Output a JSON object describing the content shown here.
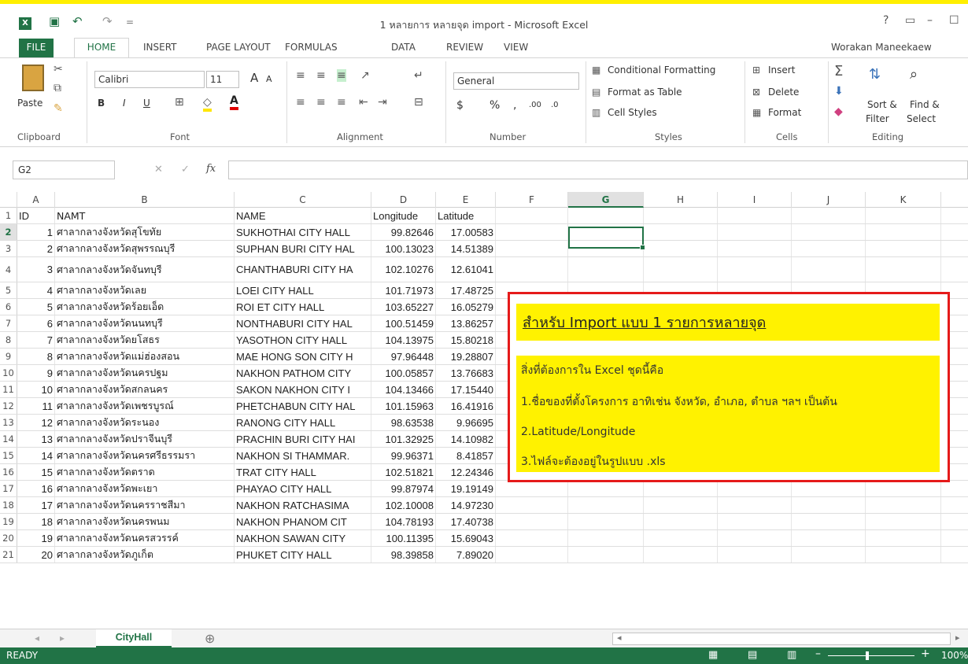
{
  "window": {
    "title": "1 หลายการ หลายจุด import - Microsoft Excel",
    "help": "?",
    "restore": "▭",
    "minimize": "–",
    "maximize": "☐"
  },
  "qat": {
    "undo": "↶",
    "redo": "↷",
    "save": "▣",
    "customize": "="
  },
  "tabs": [
    "FILE",
    "HOME",
    "INSERT",
    "PAGE LAYOUT",
    "FORMULAS",
    "DATA",
    "REVIEW",
    "VIEW"
  ],
  "user": "Worakan Maneekaew",
  "ribbon": {
    "clipboard": {
      "label": "Clipboard",
      "paste": "Paste"
    },
    "font": {
      "label": "Font",
      "name": "Calibri",
      "size": "11",
      "bold": "B",
      "italic": "I",
      "underline": "U",
      "grow": "A",
      "shrink": "A"
    },
    "alignment": {
      "label": "Alignment"
    },
    "number": {
      "label": "Number",
      "format": "General",
      "currency": "$",
      "percent": "%",
      "comma": ",",
      "inc_decimal": ".00",
      "dec_decimal": ".0"
    },
    "styles": {
      "label": "Styles",
      "conditional": "Conditional Formatting",
      "format_table": "Format as Table",
      "cell_styles": "Cell Styles"
    },
    "cells": {
      "label": "Cells",
      "insert": "Insert",
      "delete": "Delete",
      "format": "Format"
    },
    "editing": {
      "label": "Editing",
      "sort": "Sort &",
      "sort2": "Filter",
      "find": "Find &",
      "find2": "Select"
    }
  },
  "formula_bar": {
    "name_box": "G2",
    "fx": "fx",
    "value": ""
  },
  "columns": [
    "A",
    "B",
    "C",
    "D",
    "E",
    "F",
    "G",
    "H",
    "I",
    "J",
    "K"
  ],
  "rows": [
    {
      "n": "1",
      "a": "ID",
      "b": "NAMT",
      "c": "NAME",
      "d": "Longitude",
      "e": "Latitude"
    },
    {
      "n": "2",
      "a": "1",
      "b": "ศาลากลางจังหวัดสุโขทัย",
      "c": "SUKHOTHAI CITY HALL",
      "d": "99.82646",
      "e": "17.00583"
    },
    {
      "n": "3",
      "a": "2",
      "b": "ศาลากลางจังหวัดสุพรรณบุรี",
      "c": "SUPHAN BURI CITY HAL",
      "d": "100.13023",
      "e": "14.51389"
    },
    {
      "n": "4",
      "a": "3",
      "b": "ศาลากลางจังหวัดจันทบุรี",
      "c": "CHANTHABURI CITY HA",
      "d": "102.10276",
      "e": "12.61041"
    },
    {
      "n": "5",
      "a": "4",
      "b": "ศาลากลางจังหวัดเลย",
      "c": "LOEI CITY HALL",
      "d": "101.71973",
      "e": "17.48725"
    },
    {
      "n": "6",
      "a": "5",
      "b": "ศาลากลางจังหวัดร้อยเอ็ด",
      "c": "ROI ET CITY HALL",
      "d": "103.65227",
      "e": "16.05279"
    },
    {
      "n": "7",
      "a": "6",
      "b": "ศาลากลางจังหวัดนนทบุรี",
      "c": "NONTHABURI CITY HAL",
      "d": "100.51459",
      "e": "13.86257"
    },
    {
      "n": "8",
      "a": "7",
      "b": "ศาลากลางจังหวัดยโสธร",
      "c": "YASOTHON CITY HALL",
      "d": "104.13975",
      "e": "15.80218"
    },
    {
      "n": "9",
      "a": "8",
      "b": "ศาลากลางจังหวัดแม่ฮ่องสอน",
      "c": "MAE HONG SON CITY H",
      "d": "97.96448",
      "e": "19.28807"
    },
    {
      "n": "10",
      "a": "9",
      "b": "ศาลากลางจังหวัดนครปฐม",
      "c": "NAKHON PATHOM CITY",
      "d": "100.05857",
      "e": "13.76683"
    },
    {
      "n": "11",
      "a": "10",
      "b": "ศาลากลางจังหวัดสกลนคร",
      "c": "SAKON NAKHON CITY I",
      "d": "104.13466",
      "e": "17.15440"
    },
    {
      "n": "12",
      "a": "11",
      "b": "ศาลากลางจังหวัดเพชรบูรณ์",
      "c": "PHETCHABUN CITY HAL",
      "d": "101.15963",
      "e": "16.41916"
    },
    {
      "n": "13",
      "a": "12",
      "b": "ศาลากลางจังหวัดระนอง",
      "c": "RANONG CITY HALL",
      "d": "98.63538",
      "e": "9.96695"
    },
    {
      "n": "14",
      "a": "13",
      "b": "ศาลากลางจังหวัดปราจีนบุรี",
      "c": "PRACHIN BURI CITY HAI",
      "d": "101.32925",
      "e": "14.10982"
    },
    {
      "n": "15",
      "a": "14",
      "b": "ศาลากลางจังหวัดนครศรีธรรมรา",
      "c": "NAKHON SI THAMMAR.",
      "d": "99.96371",
      "e": "8.41857"
    },
    {
      "n": "16",
      "a": "15",
      "b": "ศาลากลางจังหวัดตราด",
      "c": "TRAT CITY HALL",
      "d": "102.51821",
      "e": "12.24346"
    },
    {
      "n": "17",
      "a": "16",
      "b": "ศาลากลางจังหวัดพะเยา",
      "c": "PHAYAO CITY HALL",
      "d": "99.87974",
      "e": "19.19149"
    },
    {
      "n": "18",
      "a": "17",
      "b": "ศาลากลางจังหวัดนครราชสีมา",
      "c": "NAKHON RATCHASIMA",
      "d": "102.10008",
      "e": "14.97230"
    },
    {
      "n": "19",
      "a": "18",
      "b": "ศาลากลางจังหวัดนครพนม",
      "c": "NAKHON PHANOM CIT",
      "d": "104.78193",
      "e": "17.40738"
    },
    {
      "n": "20",
      "a": "19",
      "b": "ศาลากลางจังหวัดนครสวรรค์",
      "c": "NAKHON SAWAN CITY",
      "d": "100.11395",
      "e": "15.69043"
    },
    {
      "n": "21",
      "a": "20",
      "b": "ศาลากลางจังหวัดภูเก็ต",
      "c": "PHUKET CITY HALL",
      "d": "98.39858",
      "e": "7.89020"
    }
  ],
  "note": {
    "title": "สำหรับ Import แบบ 1 รายการหลายจุด",
    "lines": [
      "สิ่งที่ต้องการใน Excel ชุดนี้คือ",
      "1.ชื่อของที่ตั้งโครงการ อาทิเช่น จังหวัด, อำเภอ, ตำบล ฯลฯ เป็นต้น",
      "2.Latitude/Longitude",
      "3.ไฟล์จะต้องอยู่ในรูปแบบ .xls"
    ]
  },
  "sheet": {
    "tab": "CityHall",
    "add": "⊕"
  },
  "status": {
    "ready": "READY",
    "zoom": "100%"
  },
  "colors": {
    "excel_green": "#217346",
    "highlight": "#fff200",
    "note_border": "#e51a1a"
  }
}
